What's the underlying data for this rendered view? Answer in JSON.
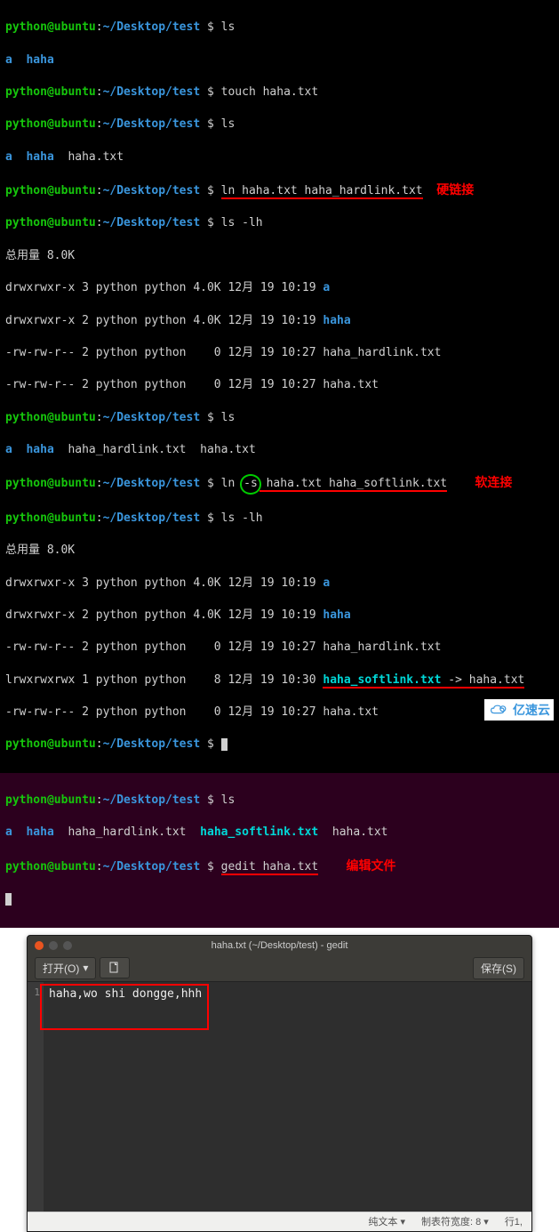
{
  "prompt": {
    "user": "python@ubuntu",
    "sep": ":",
    "path": "~/Desktop/test",
    "sym": "$"
  },
  "cmd": {
    "ls": "ls",
    "touch": "touch haha.txt",
    "ln_hard": "ln haha.txt haha_hardlink.txt",
    "ls_lh": "ls -lh",
    "ln_soft_prefix": "ln ",
    "ln_soft_flag": "-s",
    "ln_soft_rest": " haha.txt haha_softlink.txt",
    "gedit": "gedit haha.txt"
  },
  "out": {
    "a": "a",
    "haha": "haha",
    "haha_txt": "haha.txt",
    "hardlink": "haha_hardlink.txt",
    "softlink": "haha_softlink.txt",
    "total": "总用量 8.0K",
    "row1": "drwxrwxr-x 3 python python 4.0K 12月 19 10:19 ",
    "row2": "drwxrwxr-x 2 python python 4.0K 12月 19 10:19 ",
    "row3": "-rw-rw-r-- 2 python python    0 12月 19 10:27 haha_hardlink.txt",
    "row4": "-rw-rw-r-- 2 python python    0 12月 19 10:27 haha.txt",
    "row5": "lrwxrwxrwx 1 python python    8 12月 19 10:30 ",
    "row5_arrow": " -> haha.txt",
    "row6": "-rw-rw-r-- 2 python python    0 12月 19 10:27 haha.txt"
  },
  "anno": {
    "hardlink": "硬链接",
    "softlink": "软连接",
    "edit": "编辑文件"
  },
  "gedit": {
    "title": "haha.txt (~/Desktop/test) - gedit",
    "open": "打开(O)",
    "save": "保存(S)",
    "line1_num": "1",
    "content": "haha,wo shi  dongge,hhh",
    "status_plain": "纯文本 ▾",
    "status_tab": "制表符宽度: 8 ▾",
    "status_pos": "行1,"
  },
  "watermark": {
    "text": "亿速云"
  }
}
